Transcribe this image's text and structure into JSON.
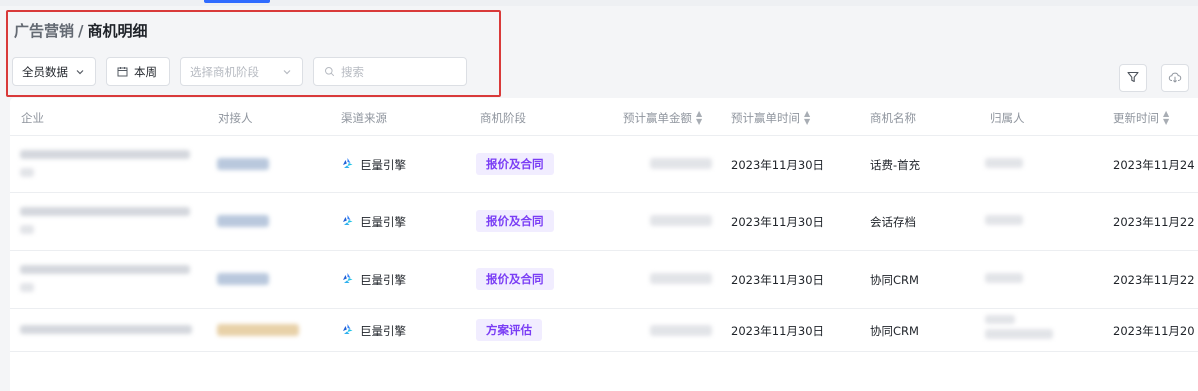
{
  "breadcrumb": {
    "parent": "广告营销",
    "separator": "/",
    "current": "商机明细"
  },
  "filters": {
    "scope_label": "全员数据",
    "week_label": "本周",
    "stage_placeholder": "选择商机阶段",
    "search_placeholder": "搜索"
  },
  "colors": {
    "accent": "#2f6bff",
    "tag_bg": "#f1edff",
    "tag_text": "#7a3df5",
    "highlight_border": "#d93a3a"
  },
  "table": {
    "columns": [
      "企业",
      "对接人",
      "渠道来源",
      "商机阶段",
      "预计赢单金额",
      "预计赢单时间",
      "商机名称",
      "归属人",
      "更新时间"
    ],
    "sortable_columns": [
      "预计赢单金额",
      "预计赢单时间",
      "更新时间"
    ],
    "rows": [
      {
        "source": "巨量引擎",
        "stage": "报价及合同",
        "close_date": "2023年11月30日",
        "name": "话费-首充",
        "updated": "2023年11月24"
      },
      {
        "source": "巨量引擎",
        "stage": "报价及合同",
        "close_date": "2023年11月30日",
        "name": "会话存档",
        "updated": "2023年11月22"
      },
      {
        "source": "巨量引擎",
        "stage": "报价及合同",
        "close_date": "2023年11月30日",
        "name": "协同CRM",
        "updated": "2023年11月22"
      },
      {
        "source": "巨量引擎",
        "stage": "方案评估",
        "close_date": "2023年11月30日",
        "name": "协同CRM",
        "updated": "2023年11月20"
      }
    ]
  },
  "icons": {
    "scope_chevron": "chevron-down-icon",
    "week": "calendar-icon",
    "stage_chevron": "chevron-down-icon",
    "search": "search-icon",
    "filter": "filter-icon",
    "cloud": "cloud-download-icon",
    "source": "ocean-engine-logo-icon"
  }
}
